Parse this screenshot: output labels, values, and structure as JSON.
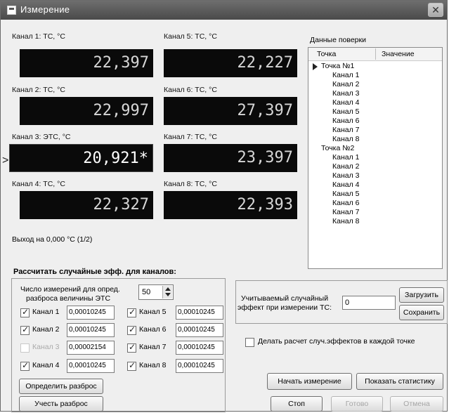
{
  "window": {
    "title": "Измерение",
    "close": "✕"
  },
  "channels": [
    {
      "label": "Канал 1: ТС, °С",
      "value": "22,397"
    },
    {
      "label": "Канал 2: ТС, °С",
      "value": "22,997"
    },
    {
      "label": "Канал 3: ЭТС, °С",
      "value": "20,921*"
    },
    {
      "label": "Канал 4: ТС, °С",
      "value": "22,327"
    },
    {
      "label": "Канал 5: ТС, °С",
      "value": "22,227"
    },
    {
      "label": "Канал 6: ТС, °С",
      "value": "27,397"
    },
    {
      "label": "Канал 7: ТС, °С",
      "value": "23,397"
    },
    {
      "label": "Канал 8: ТС, °С",
      "value": "22,393"
    }
  ],
  "active_pointer": ">",
  "output_status": "Выход на 0,000 °С (1/2)",
  "verification": {
    "title": "Данные поверки",
    "columns": [
      "Точка",
      "Значение"
    ],
    "rows": [
      "Точка №1",
      "Канал 1",
      "Канал 2",
      "Канал 3",
      "Канал 4",
      "Канал 5",
      "Канал 6",
      "Канал 7",
      "Канал 8",
      "Точка №2",
      "Канал 1",
      "Канал 2",
      "Канал 3",
      "Канал 4",
      "Канал 5",
      "Канал 6",
      "Канал 7",
      "Канал 8"
    ]
  },
  "random": {
    "section_title": "Рассчитать случайные эфф. для каналов:",
    "count_label_1": "Число измерений для опред.",
    "count_label_2": "разброса величины ЭТС",
    "count_value": "50",
    "channels": [
      {
        "label": "Канал 1",
        "value": "0,00010245",
        "checked": true,
        "enabled": true
      },
      {
        "label": "Канал 2",
        "value": "0,00010245",
        "checked": true,
        "enabled": true
      },
      {
        "label": "Канал 3",
        "value": "0,00002154",
        "checked": false,
        "enabled": false
      },
      {
        "label": "Канал 4",
        "value": "0,00010245",
        "checked": true,
        "enabled": true
      },
      {
        "label": "Канал 5",
        "value": "0,00010245",
        "checked": true,
        "enabled": true
      },
      {
        "label": "Канал 6",
        "value": "0,00010245",
        "checked": true,
        "enabled": true
      },
      {
        "label": "Канал 7",
        "value": "0,00010245",
        "checked": true,
        "enabled": true
      },
      {
        "label": "Канал 8",
        "value": "0,00010245",
        "checked": true,
        "enabled": true
      }
    ],
    "determine_btn": "Определить разброс",
    "account_btn": "Учесть разброс"
  },
  "effect": {
    "label_1": "Учитываемый случайный",
    "label_2": "эффект при измерении ТС:",
    "value": "0",
    "load_btn": "Загрузить",
    "save_btn": "Сохранить"
  },
  "each_point_label": "Делать расчет случ.эффектов в каждой точке",
  "buttons": {
    "start": "Начать измерение",
    "stats": "Показать статистику",
    "stop": "Стоп",
    "ready": "Готово",
    "cancel": "Отмена"
  }
}
